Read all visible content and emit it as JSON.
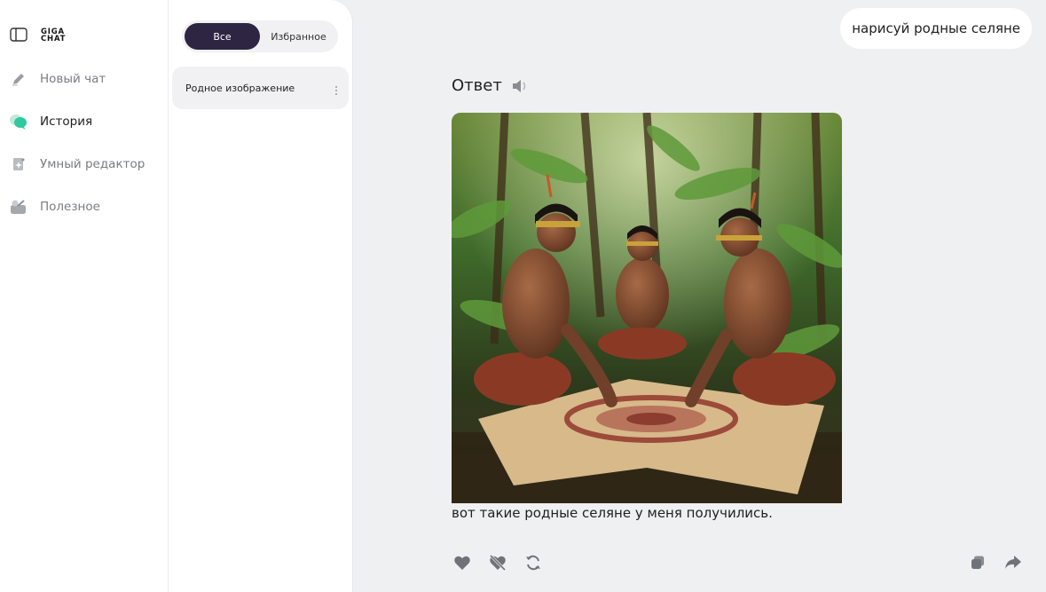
{
  "nav": {
    "logo_line1": "GIGA",
    "logo_line2": "CHAT",
    "items": [
      {
        "label": "Новый чат",
        "icon": "pencil-icon"
      },
      {
        "label": "История",
        "icon": "chat-bubbles-icon"
      },
      {
        "label": "Умный редактор",
        "icon": "smart-editor-icon"
      },
      {
        "label": "Полезное",
        "icon": "useful-icon"
      }
    ],
    "active_item": "История",
    "accent_color": "#2fc8a0"
  },
  "history": {
    "tabs": {
      "all": "Все",
      "favorites": "Избранное"
    },
    "selected_tab": "Все",
    "items": [
      {
        "title": "Родное изображение"
      }
    ]
  },
  "chat": {
    "user_message": "нарисуй родные селяне",
    "response_title": "Ответ",
    "image_alt": "generated-image",
    "caption": "вот такие родные селяне у меня получились.",
    "actions": [
      "like-icon",
      "dislike-icon",
      "regenerate-icon",
      "copy-icon",
      "share-icon"
    ]
  },
  "colors": {
    "segment_active": "#2d2542",
    "background": "#eef0f2"
  }
}
